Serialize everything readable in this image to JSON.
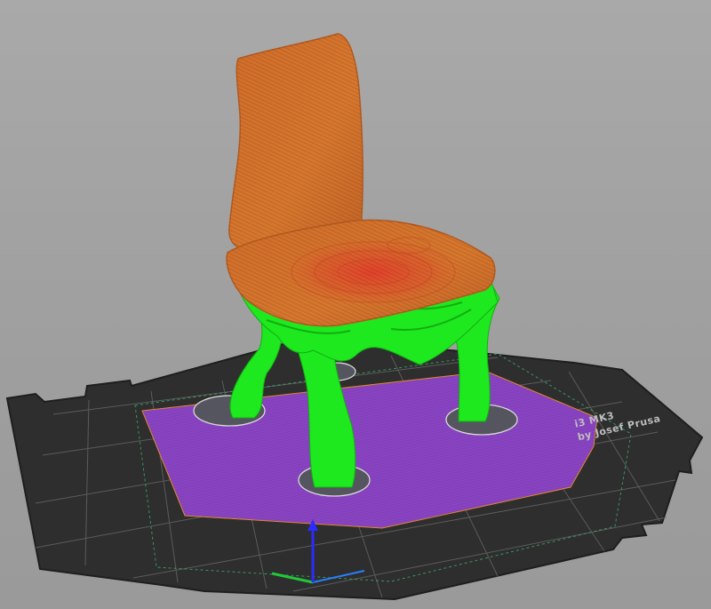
{
  "bed_label": {
    "model": "i3 MK3",
    "maker": "by Josef Prusa"
  },
  "colors": {
    "background": "#a3a3a3",
    "bed": "#2e2e2e",
    "bed_grid": "#6a6a6a",
    "first_layer": "#8a44c4",
    "model_body": "#d9762c",
    "model_highlight": "#e5412b",
    "support": "#1ee81e",
    "axis_x": "#23c53b",
    "axis_y": "#2a7fff",
    "axis_z": "#2b2bff"
  }
}
